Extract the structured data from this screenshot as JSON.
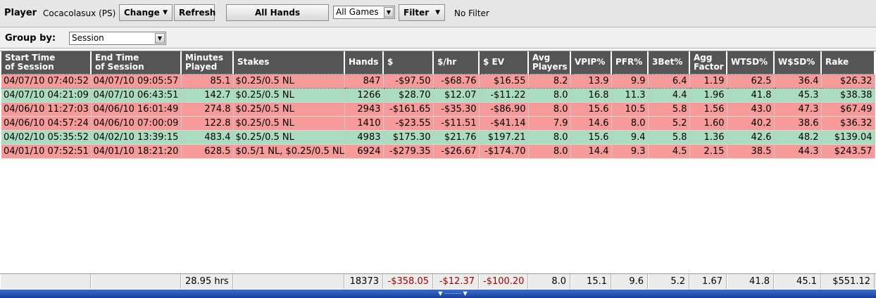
{
  "toolbar": {
    "player_label": "Player",
    "player_name": "Cocacolasux (PS)",
    "change_label": "Change",
    "refresh_label": "Refresh",
    "all_hands_label": "All Hands",
    "games_value": "All Games",
    "filter_label": "Filter",
    "filter_status": "No Filter"
  },
  "group": {
    "label": "Group by:",
    "value": "Session"
  },
  "table": {
    "headers": [
      {
        "l1": "Start Time",
        "l2": "of Session"
      },
      {
        "l1": "End Time",
        "l2": "of Session"
      },
      {
        "l1": "Minutes",
        "l2": "Played"
      },
      {
        "l1": "Stakes",
        "l2": ""
      },
      {
        "l1": "Hands",
        "l2": ""
      },
      {
        "l1": "$",
        "l2": ""
      },
      {
        "l1": "$/hr",
        "l2": ""
      },
      {
        "l1": "$ EV",
        "l2": ""
      },
      {
        "l1": "Avg",
        "l2": "Players"
      },
      {
        "l1": "VPIP%",
        "l2": ""
      },
      {
        "l1": "PFR%",
        "l2": ""
      },
      {
        "l1": "3Bet%",
        "l2": ""
      },
      {
        "l1": "Agg",
        "l2": "Factor"
      },
      {
        "l1": "WTSD%",
        "l2": ""
      },
      {
        "l1": "W$SD%",
        "l2": ""
      },
      {
        "l1": "Rake",
        "l2": ""
      }
    ],
    "rows": [
      {
        "status": "loss",
        "selected": true,
        "cells": [
          "04/07/10 07:40:52",
          "04/07/10 09:05:57",
          "85.1",
          "$0.25/0.5 NL",
          "847",
          "-$97.50",
          "-$68.76",
          "$16.55",
          "8.2",
          "13.9",
          "9.9",
          "6.4",
          "1.19",
          "62.5",
          "36.4",
          "$26.32"
        ]
      },
      {
        "status": "win",
        "selected": false,
        "cells": [
          "04/07/10 04:21:09",
          "04/07/10 06:43:51",
          "142.7",
          "$0.25/0.5 NL",
          "1266",
          "$28.70",
          "$12.07",
          "-$11.22",
          "8.0",
          "16.8",
          "11.3",
          "4.4",
          "1.96",
          "41.8",
          "45.3",
          "$38.38"
        ]
      },
      {
        "status": "loss",
        "selected": false,
        "cells": [
          "04/06/10 11:27:03",
          "04/06/10 16:01:49",
          "274.8",
          "$0.25/0.5 NL",
          "2943",
          "-$161.65",
          "-$35.30",
          "-$86.90",
          "8.0",
          "15.6",
          "10.5",
          "5.8",
          "1.56",
          "43.0",
          "47.3",
          "$67.49"
        ]
      },
      {
        "status": "loss",
        "selected": false,
        "cells": [
          "04/06/10 04:57:24",
          "04/06/10 07:00:09",
          "122.8",
          "$0.25/0.5 NL",
          "1410",
          "-$23.55",
          "-$11.51",
          "-$41.14",
          "7.9",
          "14.6",
          "8.0",
          "5.2",
          "1.60",
          "40.2",
          "38.6",
          "$36.32"
        ]
      },
      {
        "status": "win",
        "selected": false,
        "cells": [
          "04/02/10 05:35:52",
          "04/02/10 13:39:15",
          "483.4",
          "$0.25/0.5 NL",
          "4983",
          "$175.30",
          "$21.76",
          "$197.21",
          "8.0",
          "15.6",
          "9.4",
          "5.8",
          "1.36",
          "42.6",
          "48.2",
          "$139.04"
        ]
      },
      {
        "status": "loss",
        "selected": false,
        "cells": [
          "04/01/10 07:52:51",
          "04/01/10 18:21:20",
          "628.5",
          "$0.5/1 NL, $0.25/0.5 NL",
          "6924",
          "-$279.35",
          "-$26.67",
          "-$174.70",
          "8.0",
          "14.4",
          "9.3",
          "4.5",
          "2.15",
          "38.5",
          "44.3",
          "$243.57"
        ]
      }
    ]
  },
  "totals": {
    "minutes": "28.95 hrs",
    "hands": "18373",
    "dollars": "-$358.05",
    "dollars_hr": "-$12.37",
    "ev": "-$100.20",
    "avg_players": "8.0",
    "vpip": "15.1",
    "pfr": "9.6",
    "threebet": "5.2",
    "agg": "1.67",
    "wtsd": "41.8",
    "wsd": "45.1",
    "rake": "$551.12"
  },
  "colors": {
    "loss_row": "#f79a9a",
    "win_row": "#abdcc0",
    "header_bg": "#555555",
    "negative_total": "#a00000"
  }
}
